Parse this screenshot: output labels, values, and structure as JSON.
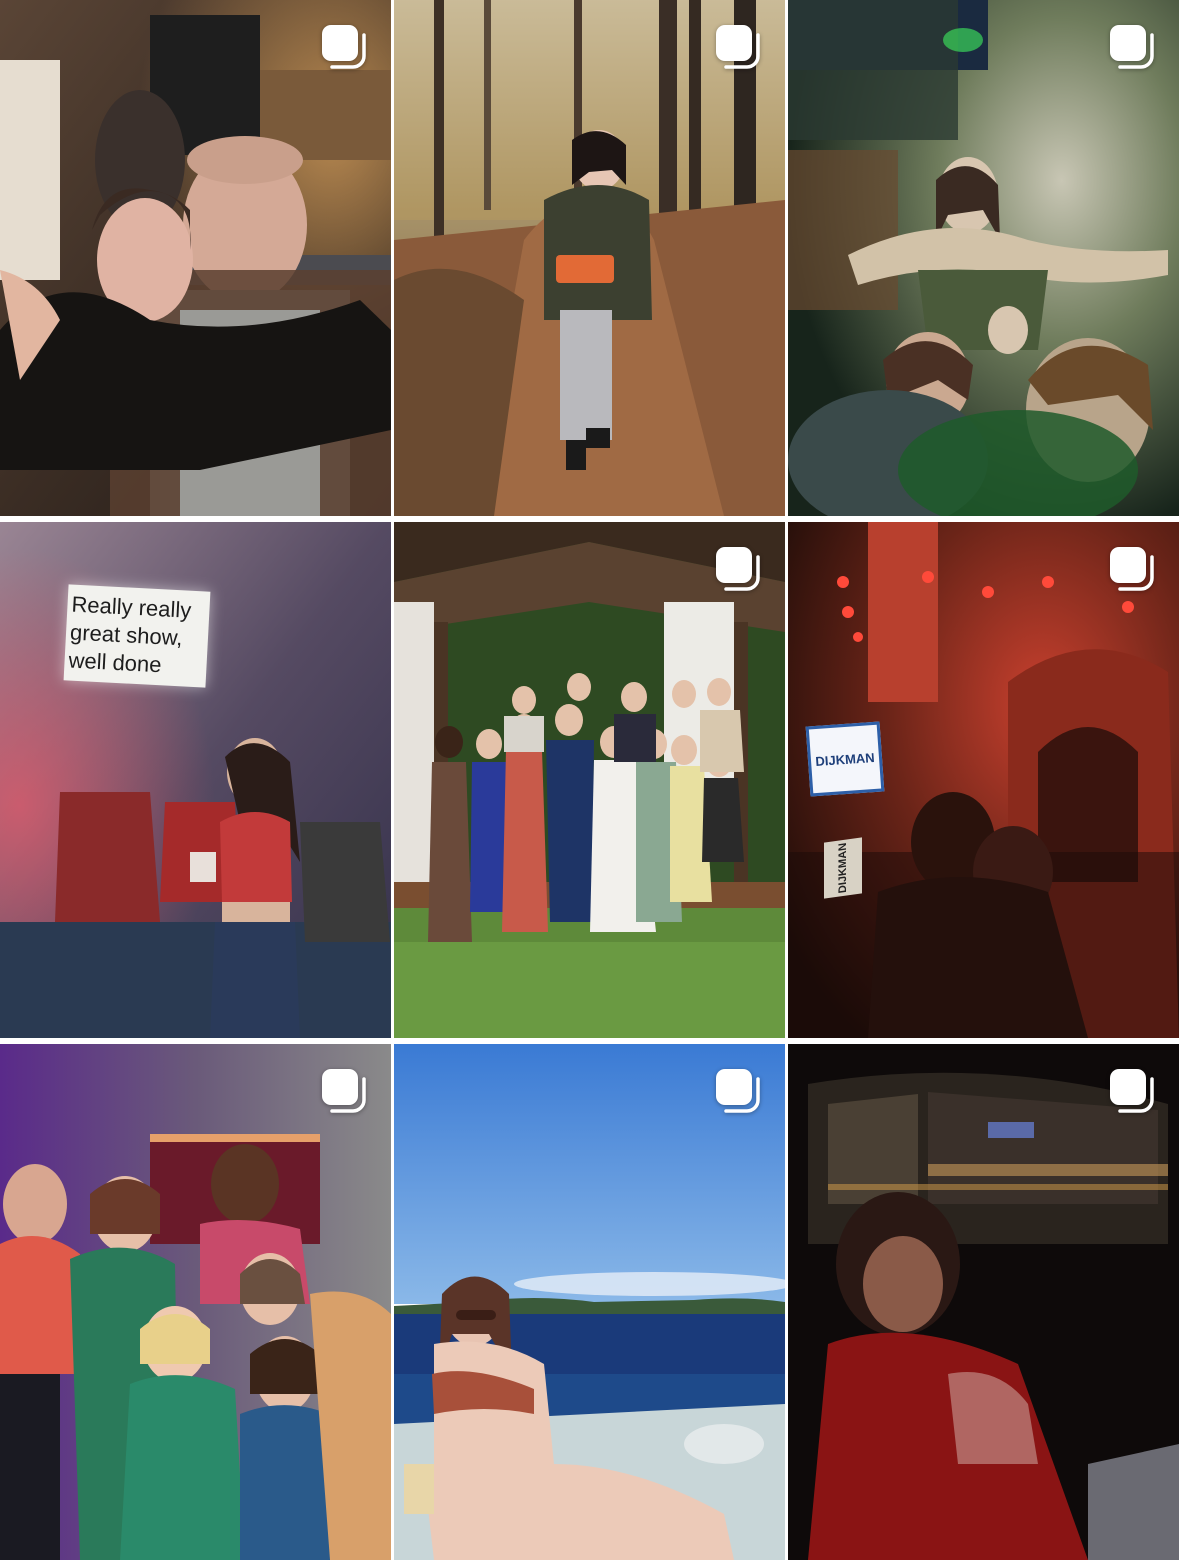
{
  "grid": {
    "posts": [
      {
        "id": "post-1",
        "multi": true
      },
      {
        "id": "post-2",
        "multi": true
      },
      {
        "id": "post-3",
        "multi": true
      },
      {
        "id": "post-4",
        "multi": false,
        "projection_text": "Really really\ngreat show,\nwell done"
      },
      {
        "id": "post-5",
        "multi": true
      },
      {
        "id": "post-6",
        "multi": true,
        "sign_text": "DIJKMAN",
        "street_sign_text": "DIJKMAN"
      },
      {
        "id": "post-7",
        "multi": true
      },
      {
        "id": "post-8",
        "multi": true
      },
      {
        "id": "post-9",
        "multi": true
      }
    ]
  },
  "icons": {
    "multi_post": "carousel-icon"
  }
}
